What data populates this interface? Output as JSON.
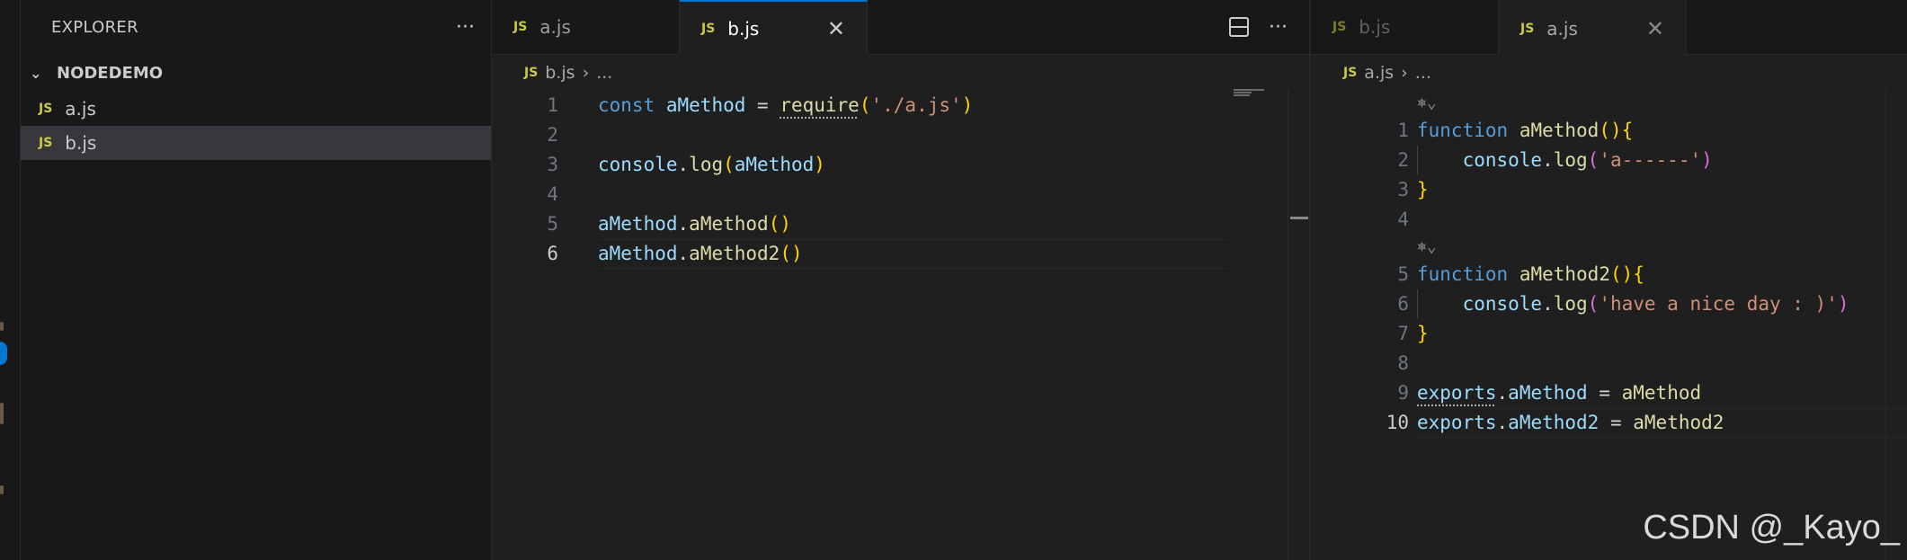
{
  "sidebar": {
    "title": "EXPLORER",
    "more_icon": "ellipsis-icon",
    "folder": "NODEDEMO",
    "files": [
      {
        "icon": "JS",
        "name": "a.js",
        "selected": false
      },
      {
        "icon": "JS",
        "name": "b.js",
        "selected": true
      }
    ]
  },
  "left_editor": {
    "tabs": [
      {
        "icon": "JS",
        "label": "a.js",
        "active": false
      },
      {
        "icon": "JS",
        "label": "b.js",
        "active": true,
        "close": "✕"
      }
    ],
    "breadcrumb": {
      "icon": "JS",
      "file": "b.js",
      "sep": "›",
      "rest": "..."
    },
    "lines": [
      {
        "n": "1",
        "tokens": [
          {
            "t": "const",
            "c": "kw"
          },
          {
            "t": " ",
            "c": "pl"
          },
          {
            "t": "aMethod",
            "c": "var"
          },
          {
            "t": " = ",
            "c": "pl"
          },
          {
            "t": "require",
            "c": "fn squig"
          },
          {
            "t": "(",
            "c": "br1"
          },
          {
            "t": "'./a.js'",
            "c": "str"
          },
          {
            "t": ")",
            "c": "br1"
          }
        ]
      },
      {
        "n": "2",
        "tokens": []
      },
      {
        "n": "3",
        "tokens": [
          {
            "t": "console",
            "c": "var"
          },
          {
            "t": ".",
            "c": "pl"
          },
          {
            "t": "log",
            "c": "fn"
          },
          {
            "t": "(",
            "c": "br1"
          },
          {
            "t": "aMethod",
            "c": "var"
          },
          {
            "t": ")",
            "c": "br1"
          }
        ]
      },
      {
        "n": "4",
        "tokens": []
      },
      {
        "n": "5",
        "tokens": [
          {
            "t": "aMethod",
            "c": "var"
          },
          {
            "t": ".",
            "c": "pl"
          },
          {
            "t": "aMethod",
            "c": "fn"
          },
          {
            "t": "()",
            "c": "br1"
          }
        ]
      },
      {
        "n": "6",
        "current": true,
        "tokens": [
          {
            "t": "aMethod",
            "c": "var"
          },
          {
            "t": ".",
            "c": "pl"
          },
          {
            "t": "aMethod2",
            "c": "fn"
          },
          {
            "t": "()",
            "c": "br1"
          }
        ]
      }
    ]
  },
  "right_editor": {
    "tabs": [
      {
        "icon": "JS",
        "label": "b.js",
        "active": false
      },
      {
        "icon": "JS",
        "label": "a.js",
        "active": true,
        "close": "✕"
      }
    ],
    "breadcrumb": {
      "icon": "JS",
      "file": "a.js",
      "sep": "›",
      "rest": "..."
    },
    "codelens": "⎈⌄",
    "lines": [
      {
        "lens": true
      },
      {
        "n": "1",
        "tokens": [
          {
            "t": "function",
            "c": "kw"
          },
          {
            "t": " ",
            "c": "pl"
          },
          {
            "t": "aMethod",
            "c": "fn"
          },
          {
            "t": "()",
            "c": "br1"
          },
          {
            "t": "{",
            "c": "br1"
          }
        ]
      },
      {
        "n": "2",
        "tokens": [
          {
            "t": "    console",
            "c": "var"
          },
          {
            "t": ".",
            "c": "pl"
          },
          {
            "t": "log",
            "c": "fn"
          },
          {
            "t": "(",
            "c": "br2"
          },
          {
            "t": "'a------'",
            "c": "str"
          },
          {
            "t": ")",
            "c": "br2"
          }
        ]
      },
      {
        "n": "3",
        "tokens": [
          {
            "t": "}",
            "c": "br1"
          }
        ]
      },
      {
        "n": "4",
        "tokens": []
      },
      {
        "lens": true
      },
      {
        "n": "5",
        "tokens": [
          {
            "t": "function",
            "c": "kw"
          },
          {
            "t": " ",
            "c": "pl"
          },
          {
            "t": "aMethod2",
            "c": "fn"
          },
          {
            "t": "()",
            "c": "br1"
          },
          {
            "t": "{",
            "c": "br1"
          }
        ]
      },
      {
        "n": "6",
        "tokens": [
          {
            "t": "    console",
            "c": "var"
          },
          {
            "t": ".",
            "c": "pl"
          },
          {
            "t": "log",
            "c": "fn"
          },
          {
            "t": "(",
            "c": "br2"
          },
          {
            "t": "'have a nice day : )'",
            "c": "str"
          },
          {
            "t": ")",
            "c": "br2"
          }
        ]
      },
      {
        "n": "7",
        "tokens": [
          {
            "t": "}",
            "c": "br1"
          }
        ]
      },
      {
        "n": "8",
        "tokens": []
      },
      {
        "n": "9",
        "tokens": [
          {
            "t": "exports",
            "c": "var squig"
          },
          {
            "t": ".",
            "c": "pl"
          },
          {
            "t": "aMethod",
            "c": "var"
          },
          {
            "t": " = ",
            "c": "pl"
          },
          {
            "t": "aMethod",
            "c": "fn"
          }
        ]
      },
      {
        "n": "10",
        "current": true,
        "tokens": [
          {
            "t": "exports",
            "c": "var"
          },
          {
            "t": ".",
            "c": "pl"
          },
          {
            "t": "aMethod2",
            "c": "var"
          },
          {
            "t": " = ",
            "c": "pl"
          },
          {
            "t": "aMethod2",
            "c": "fn"
          }
        ]
      }
    ]
  },
  "toolbar": {
    "split_icon": "split-editor-icon",
    "more": "···"
  },
  "watermark": "CSDN @_Kayo_",
  "colors": {
    "accent": "#0078d4",
    "js_icon": "#cbcb41",
    "keyword": "#569cd6",
    "function": "#dcdcaa",
    "variable": "#9cdcfe",
    "string": "#ce9178"
  }
}
